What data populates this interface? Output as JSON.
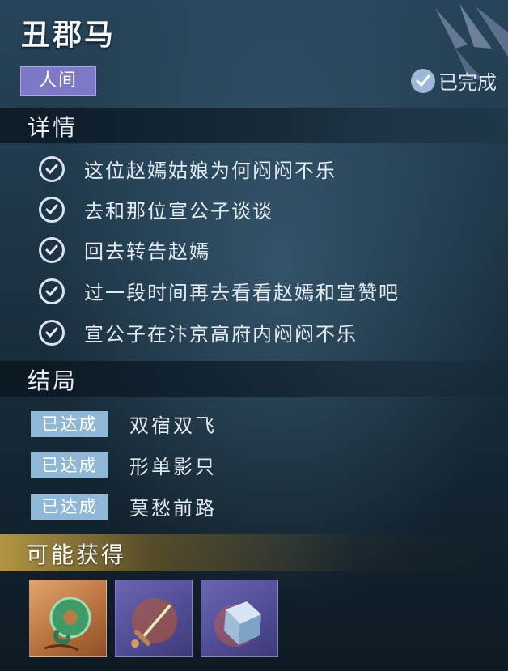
{
  "header": {
    "title": "丑郡马",
    "realm_tag": "人间",
    "status_label": "已完成"
  },
  "details": {
    "title": "详情",
    "tasks": [
      "这位赵嫣姑娘为何闷闷不乐",
      "去和那位宣公子谈谈",
      "回去转告赵嫣",
      "过一段时间再去看看赵嫣和宣赞吧",
      "宣公子在汴京高府内闷闷不乐"
    ]
  },
  "endings": {
    "title": "结局",
    "items": [
      {
        "badge": "已达成",
        "name": "双宿双飞"
      },
      {
        "badge": "已达成",
        "name": "形单影只"
      },
      {
        "badge": "已达成",
        "name": "莫愁前路"
      }
    ]
  },
  "rewards": {
    "title": "可能获得",
    "items": [
      {
        "icon": "jade-ring-icon",
        "frame_color": "#c98452"
      },
      {
        "icon": "dagger-icon",
        "frame_color": "#5a55a3"
      },
      {
        "icon": "crystal-cube-icon",
        "frame_color": "#5a55a3"
      }
    ]
  }
}
